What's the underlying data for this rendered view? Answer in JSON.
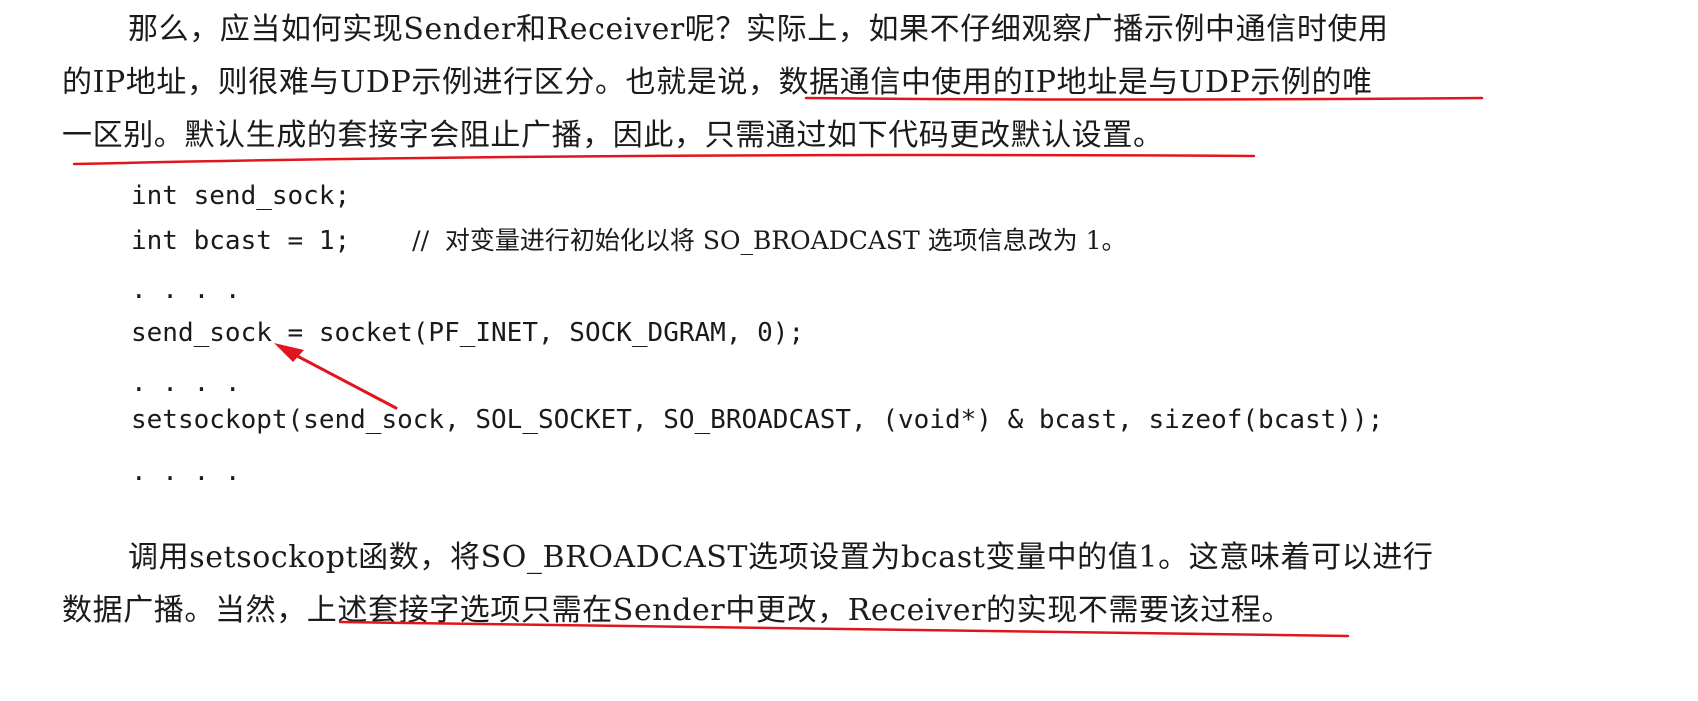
{
  "paragraph1": {
    "line1": "那么，应当如何实现Sender和Receiver呢？实际上，如果不仔细观察广播示例中通信时使用",
    "line2": "的IP地址，则很难与UDP示例进行区分。也就是说，数据通信中使用的IP地址是与UDP示例的唯",
    "line3": "一区别。默认生成的套接字会阻止广播，因此，只需通过如下代码更改默认设置。"
  },
  "code": {
    "line1": "int send_sock;",
    "line2_code": "int bcast = 1;",
    "line2_comment": "//  对变量进行初始化以将 SO_BROADCAST 选项信息改为 1。",
    "line3": ". . . .",
    "line4": "send_sock = socket(PF_INET, SOCK_DGRAM, 0);",
    "line5": ". . . .",
    "line6": "setsockopt(send_sock, SOL_SOCKET, SO_BROADCAST, (void*) & bcast, sizeof(bcast));",
    "line7": ". . . ."
  },
  "paragraph2": {
    "line1": "调用setsockopt函数，将SO_BROADCAST选项设置为bcast变量中的值1。这意味着可以进行",
    "line2": "数据广播。当然，上述套接字选项只需在Sender中更改，Receiver的实现不需要该过程。"
  },
  "annotation_color": "#e0161e"
}
